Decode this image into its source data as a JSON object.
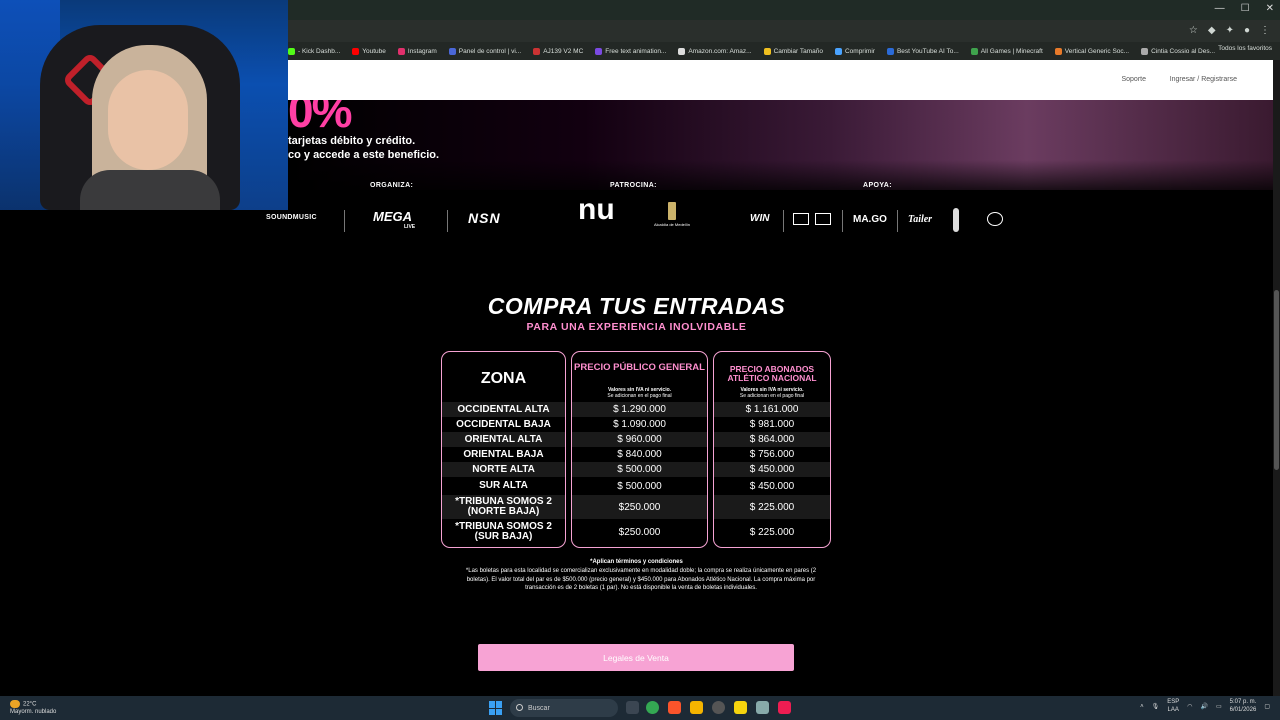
{
  "browser": {
    "bookmarks": [
      {
        "label": "- Kick Dashb...",
        "color": "#53fc18"
      },
      {
        "label": "Youtube",
        "color": "#ff0000"
      },
      {
        "label": "Instagram",
        "color": "#e1306c"
      },
      {
        "label": "Panel de control | vi...",
        "color": "#4a67d8"
      },
      {
        "label": "AJ139 V2 MC",
        "color": "#c33"
      },
      {
        "label": "Free text animation...",
        "color": "#7b4ae2"
      },
      {
        "label": "Amazon.com: Amaz...",
        "color": "#ddd"
      },
      {
        "label": "Cambiar Tamaño",
        "color": "#f0c020"
      },
      {
        "label": "Comprimir",
        "color": "#4aa3ff"
      },
      {
        "label": "Best YouTube AI To...",
        "color": "#2b6bd8"
      },
      {
        "label": "All Games | Minecraft",
        "color": "#3fa34d"
      },
      {
        "label": "Vertical Generic Soc...",
        "color": "#e87a2a"
      },
      {
        "label": "Cintia Cossio al Des...",
        "color": "#aaa"
      }
    ],
    "favorites_folder": "Todos los favoritos"
  },
  "site": {
    "support": "Soporte",
    "login": "Ingresar / Registrarse"
  },
  "hero": {
    "percent": "0%",
    "line1": "tarjetas débito y crédito.",
    "line2": "co y accede a este beneficio."
  },
  "sponsors": {
    "organiza": "ORGANIZA:",
    "patrocina": "PATROCINA:",
    "apoya": "APOYA:",
    "logos": {
      "soundmusic": "SOUNDMUSIC",
      "mega": "MEGA",
      "mega_sub": "LIVE",
      "nsn": "NSN",
      "nu": "nu",
      "alcaldia": "Alcaldía de Medellín",
      "win": "WIN",
      "mago": "MA.GO",
      "tailer": "Tailer"
    }
  },
  "tickets": {
    "title": "COMPRA TUS ENTRADAS",
    "subtitle": "PARA UNA EXPERIENCIA INOLVIDABLE",
    "zona_header": "ZONA",
    "publico_header": "PRECIO PÚBLICO GENERAL",
    "abonados_header": "PRECIO ABONADOS ATLÉTICO NACIONAL",
    "note_line1": "Valores sin IVA ni servicio.",
    "note_line2": "Se adicionan en el pago final",
    "rows": [
      {
        "zona": "OCCIDENTAL ALTA",
        "publico": "$ 1.290.000",
        "abonados": "$ 1.161.000"
      },
      {
        "zona": "OCCIDENTAL BAJA",
        "publico": "$ 1.090.000",
        "abonados": "$ 981.000"
      },
      {
        "zona": "ORIENTAL ALTA",
        "publico": "$ 960.000",
        "abonados": "$ 864.000"
      },
      {
        "zona": "ORIENTAL BAJA",
        "publico": "$ 840.000",
        "abonados": "$ 756.000"
      },
      {
        "zona": "NORTE ALTA",
        "publico": "$ 500.000",
        "abonados": "$ 450.000"
      },
      {
        "zona": "SUR ALTA",
        "publico": "$ 500.000",
        "abonados": "$ 450.000"
      },
      {
        "zona": "*TRIBUNA SOMOS 2 (NORTE BAJA)",
        "publico": "$250.000",
        "abonados": "$ 225.000"
      },
      {
        "zona": "*TRIBUNA SOMOS 2 (SUR BAJA)",
        "publico": "$250.000",
        "abonados": "$ 225.000"
      }
    ],
    "terms_title": "*Aplican términos y condiciones",
    "terms_text": "*Las boletas para esta localidad se comercializan exclusivamente en modalidad doble; la compra se realiza únicamente en pares (2 boletas). El valor total del par es de $500.000 (precio general) y $450.000 para Abonados Atlético Nacional. La compra máxima por transacción es de 2 boletas (1 par). No está disponible la venta de boletas individuales.",
    "legal_button": "Legales de Venta"
  },
  "taskbar": {
    "temp": "22°C",
    "weather": "Mayorm. nublado",
    "search": "Buscar",
    "lang": "ESP",
    "lang2": "LAA",
    "time": "5:07 p. m.",
    "date": "6/01/2026"
  }
}
